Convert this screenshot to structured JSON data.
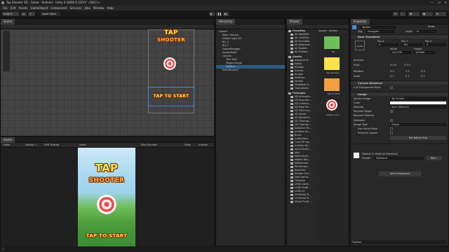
{
  "window": {
    "title": "Tap Shooter 2D - Game - Android - Unity 6 (6000.0.23f1)* <DX11>"
  },
  "menu": [
    "File",
    "Edit",
    "Assets",
    "GameObject",
    "Component",
    "Services",
    "Jobs",
    "Window",
    "Help"
  ],
  "toolbar": {
    "account": "Unity 6",
    "asset_store": "Asset Store"
  },
  "scene": {
    "tab": "Scene",
    "texts": {
      "logo_line1": "TAP",
      "logo_line2": "SHOOTER",
      "tap_to_start": "TAP TO START"
    }
  },
  "game": {
    "tab": "Game",
    "display": "Game",
    "display_num": "Display 1",
    "resolution": "FHD Portrait",
    "scale": "Scale",
    "play_focused": "Play Focused",
    "stats": "Stats",
    "gizmos": "Gizmos",
    "texts": {
      "logo_line1": "TAP",
      "logo_line2": "SHOOTER",
      "tap_to_start": "TAP TO START"
    }
  },
  "hierarchy": {
    "tab": "Hierarchy",
    "items": [
      {
        "label": "Game*",
        "indent": 0,
        "selected": false
      },
      {
        "label": "Main Camera",
        "indent": 1,
        "selected": false
      },
      {
        "label": "Global Light 2D",
        "indent": 1,
        "selected": false
      },
      {
        "label": "BG_0",
        "indent": 1,
        "selected": false
      },
      {
        "label": "BG_1",
        "indent": 1,
        "selected": false
      },
      {
        "label": "GameManager",
        "indent": 1,
        "selected": false
      },
      {
        "label": "SpawnPoint",
        "indent": 1,
        "selected": false
      },
      {
        "label": "Canvas",
        "indent": 1,
        "selected": false
      },
      {
        "label": "Title Text",
        "indent": 2,
        "selected": false
      },
      {
        "label": "Target Image",
        "indent": 2,
        "selected": false
      },
      {
        "label": "TapText",
        "indent": 2,
        "selected": true
      },
      {
        "label": "EventSystem",
        "indent": 1,
        "selected": false
      }
    ]
  },
  "project": {
    "tab": "Project",
    "favorites_label": "Favorites",
    "favorites": [
      "All Modified",
      "All Conflicts",
      "All Excluded",
      "All Materials",
      "All Models",
      "All Prefabs"
    ],
    "assets_label": "Assets",
    "assets": [
      "Adaptive P...",
      "Editor",
      "Prefabs",
      "Scenes",
      "Scripts",
      "Settings",
      "Sprites",
      "TextMesh P...",
      "Tutorialinfo"
    ],
    "packages_label": "Packages",
    "packages": [
      "2D Animatio...",
      "2D Aseprite...",
      "2D Commo...",
      "2D Pixel Pe...",
      "2D PSD Imp...",
      "2D Sprite",
      "2D SpriteSh...",
      "2D Tilemap...",
      "2D Tilemap...",
      "Adaptive Pe...",
      "Android Lo...",
      "Burst",
      "Collections",
      "Core RP Lib...",
      "Custom NU...",
      "Input Syste...",
      "Jobs",
      "Mathemati...",
      "Mobile Not...",
      "Newtonsof...",
      "Performan...",
      "Searcher",
      "Shader Gra...",
      "Test Frame...",
      "Timeline",
      "Unity Light...",
      "Unity Profil...",
      "Unity UI",
      "Universal R...",
      "Universal R...",
      "Visual Scrip..."
    ],
    "breadcrumb_root": "Assets",
    "breadcrumb_folder": "Sprites",
    "sprites": [
      {
        "name": "BG"
      },
      {
        "name": "tap-shooter..."
      },
      {
        "name": "Tap To Start"
      },
      {
        "name": "target_icon(..."
      }
    ]
  },
  "inspector": {
    "tab": "Inspector",
    "object_name": "TapText",
    "static_label": "Static",
    "tag_label": "Tag",
    "tag_value": "Untagged",
    "layer_label": "Layer",
    "layer_value": "UI",
    "rect_transform": "Rect Transform",
    "anchor_preset": "center",
    "pos_x_label": "Pos X",
    "pos_y_label": "Pos Y",
    "pos_z_label": "Pos Z",
    "pos_x": "0",
    "pos_y": "-764",
    "pos_z": "0",
    "width_label": "Width",
    "height_label": "Height",
    "width": "1003.978",
    "height": "183.868",
    "anchors": "Anchors",
    "pivot_label": "Pivot",
    "pivot_x": "X 0.5",
    "pivot_y": "Y 0.5",
    "rotation_label": "Rotation",
    "rot_x": "X 0",
    "rot_y": "Y 0",
    "rot_z": "Z 0",
    "scale_label": "Scale",
    "scale_x": "X 1",
    "scale_y": "Y 1",
    "scale_z": "Z 1",
    "canvas_renderer": "Canvas Renderer",
    "cull_label": "Cull Transparent Mesh",
    "image": "Image",
    "source_image_label": "Source Image",
    "source_image": "Tap To Start",
    "color_label": "Color",
    "material_label": "Material",
    "material_value": "None (Material)",
    "raycast_label": "Raycast Target",
    "raycast_padding_label": "Raycast Padding",
    "maskable_label": "Maskable",
    "image_type_label": "Image Type",
    "image_type": "Simple",
    "use_sprite_mesh_label": "Use Sprite Mesh",
    "preserve_aspect_label": "Preserve Aspect",
    "set_native_size": "Set Native Size",
    "material_name": "Default UI Material (Material)",
    "shader_label": "Shader",
    "shader_value": "UI/Default",
    "edit_button": "Edit...",
    "add_component": "Add Component",
    "footer": "TapText"
  },
  "status": {
    "icon": "info-icon"
  },
  "colors": {
    "selection": "#2c5d87",
    "accent_blue": "#3b76c0",
    "logo_yellow": "#ffe34d"
  }
}
